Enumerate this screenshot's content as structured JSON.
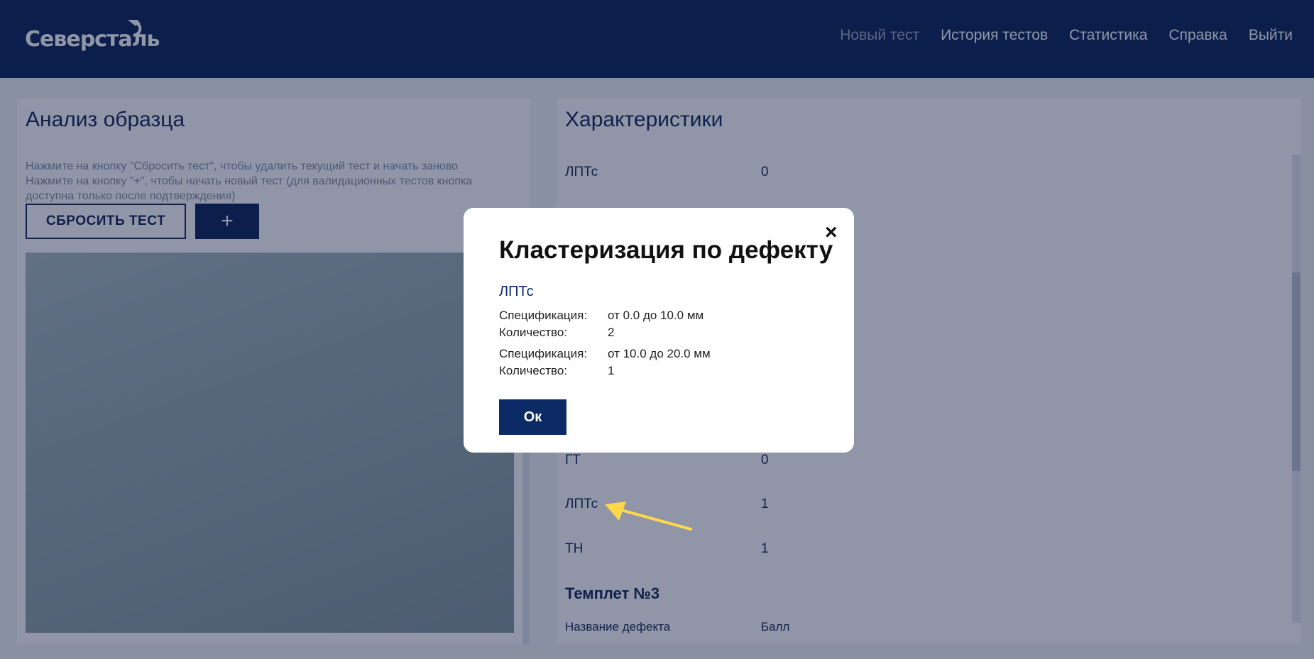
{
  "header": {
    "logo_text": "Северсталь",
    "nav": [
      "Новый тест",
      "История тестов",
      "Статистика",
      "Справка",
      "Выйти"
    ]
  },
  "left_panel": {
    "title": "Анализ образца",
    "hint_line1": "Нажмите на кнопку \"Сбросить тест\", чтобы удалить текущий тест и начать заново",
    "hint_line2": "Нажмите на кнопку \"+\", чтобы начать новый тест (для валидационных тестов кнопка доступна только после подтверждения)",
    "reset_button": "СБРОСИТЬ ТЕСТ",
    "plus_button": "+"
  },
  "right_panel": {
    "title": "Характеристики",
    "rows_top": [
      {
        "name": "ЛПТс",
        "value": "0"
      }
    ],
    "rows_bottom": [
      {
        "name": "ГТ",
        "value": "0"
      },
      {
        "name": "ЛПТс",
        "value": "1"
      },
      {
        "name": "ТН",
        "value": "1"
      }
    ],
    "templet_title": "Темплет №3",
    "col_name": "Название дефекта",
    "col_score": "Балл"
  },
  "modal": {
    "title": "Кластеризация по дефекту",
    "close_icon": "×",
    "defect": "ЛПТс",
    "groups": [
      {
        "spec_label": "Спецификация:",
        "spec_value": "от 0.0 до 10.0 мм",
        "count_label": "Количество:",
        "count_value": "2"
      },
      {
        "spec_label": "Спецификация:",
        "spec_value": "от 10.0 до 20.0 мм",
        "count_label": "Количество:",
        "count_value": "1"
      }
    ],
    "ok_button": "Ок"
  },
  "colors": {
    "header_bg": "#001a52",
    "primary": "#0a1d4f",
    "arrow": "#ffd84a"
  }
}
